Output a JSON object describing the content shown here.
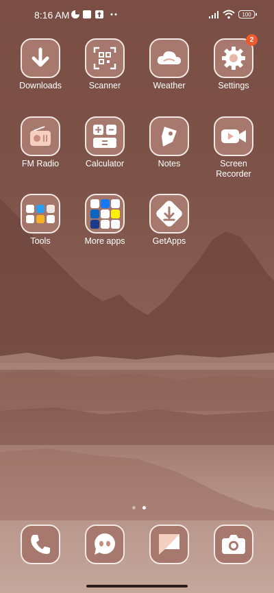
{
  "status_bar": {
    "time": "8:16 AM",
    "battery": "100"
  },
  "apps": [
    {
      "label": "Downloads"
    },
    {
      "label": "Scanner"
    },
    {
      "label": "Weather"
    },
    {
      "label": "Settings",
      "badge": "2"
    },
    {
      "label": "FM Radio"
    },
    {
      "label": "Calculator"
    },
    {
      "label": "Notes"
    },
    {
      "label": "Screen\nRecorder"
    },
    {
      "label": "Tools"
    },
    {
      "label": "More apps"
    },
    {
      "label": "GetApps"
    }
  ],
  "dock": [
    "Phone",
    "Messenger",
    "Messages",
    "Camera"
  ],
  "page_indicator": {
    "pages": 2,
    "current": 2
  },
  "colors": {
    "accent_badge": "#ef5b2c",
    "tile_bg": "#a7786d",
    "tile_border": "#f4e8e4"
  }
}
